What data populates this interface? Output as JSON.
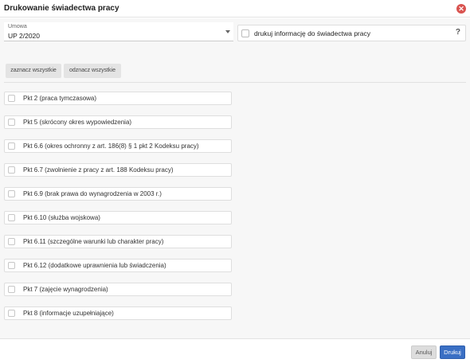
{
  "dialog": {
    "title": "Drukowanie świadectwa pracy",
    "close_icon": "close-icon"
  },
  "contract": {
    "label": "Umowa",
    "value": "UP 2/2020"
  },
  "print_info": {
    "label": "drukuj informację do świadectwa pracy",
    "help": "?"
  },
  "actions": {
    "select_all": "zaznacz wszystkie",
    "deselect_all": "odznacz wszystkie"
  },
  "items": [
    {
      "label": "Pkt 2 (praca tymczasowa)"
    },
    {
      "label": "Pkt 5 (skrócony okres wypowiedzenia)"
    },
    {
      "label": "Pkt 6.6 (okres ochronny z art. 186(8) § 1 pkt 2 Kodeksu pracy)"
    },
    {
      "label": "Pkt 6.7 (zwolnienie z pracy z art. 188 Kodeksu pracy)"
    },
    {
      "label": "Pkt 6.9 (brak prawa do wynagrodzenia w 2003 r.)"
    },
    {
      "label": "Pkt 6.10 (służba wojskowa)"
    },
    {
      "label": "Pkt 6.11 (szczególne warunki lub charakter pracy)"
    },
    {
      "label": "Pkt 6.12 (dodatkowe uprawnienia lub świadczenia)"
    },
    {
      "label": "Pkt 7 (zajęcie wynagrodzenia)"
    },
    {
      "label": "Pkt 8 (informacje uzupełniające)"
    }
  ],
  "footer": {
    "cancel": "Anuluj",
    "print": "Drukuj"
  },
  "colors": {
    "primary": "#3a6fc4",
    "close": "#d9534f"
  }
}
